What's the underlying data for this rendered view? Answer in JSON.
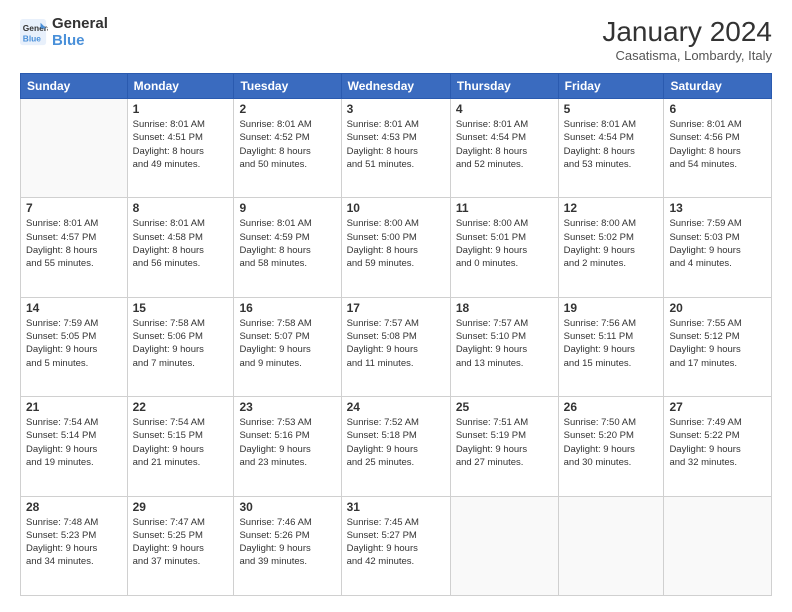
{
  "logo": {
    "line1": "General",
    "line2": "Blue"
  },
  "header": {
    "month_year": "January 2024",
    "location": "Casatisma, Lombardy, Italy"
  },
  "days_of_week": [
    "Sunday",
    "Monday",
    "Tuesday",
    "Wednesday",
    "Thursday",
    "Friday",
    "Saturday"
  ],
  "weeks": [
    [
      {
        "day": "",
        "info": ""
      },
      {
        "day": "1",
        "info": "Sunrise: 8:01 AM\nSunset: 4:51 PM\nDaylight: 8 hours\nand 49 minutes."
      },
      {
        "day": "2",
        "info": "Sunrise: 8:01 AM\nSunset: 4:52 PM\nDaylight: 8 hours\nand 50 minutes."
      },
      {
        "day": "3",
        "info": "Sunrise: 8:01 AM\nSunset: 4:53 PM\nDaylight: 8 hours\nand 51 minutes."
      },
      {
        "day": "4",
        "info": "Sunrise: 8:01 AM\nSunset: 4:54 PM\nDaylight: 8 hours\nand 52 minutes."
      },
      {
        "day": "5",
        "info": "Sunrise: 8:01 AM\nSunset: 4:54 PM\nDaylight: 8 hours\nand 53 minutes."
      },
      {
        "day": "6",
        "info": "Sunrise: 8:01 AM\nSunset: 4:56 PM\nDaylight: 8 hours\nand 54 minutes."
      }
    ],
    [
      {
        "day": "7",
        "info": "Sunrise: 8:01 AM\nSunset: 4:57 PM\nDaylight: 8 hours\nand 55 minutes."
      },
      {
        "day": "8",
        "info": "Sunrise: 8:01 AM\nSunset: 4:58 PM\nDaylight: 8 hours\nand 56 minutes."
      },
      {
        "day": "9",
        "info": "Sunrise: 8:01 AM\nSunset: 4:59 PM\nDaylight: 8 hours\nand 58 minutes."
      },
      {
        "day": "10",
        "info": "Sunrise: 8:00 AM\nSunset: 5:00 PM\nDaylight: 8 hours\nand 59 minutes."
      },
      {
        "day": "11",
        "info": "Sunrise: 8:00 AM\nSunset: 5:01 PM\nDaylight: 9 hours\nand 0 minutes."
      },
      {
        "day": "12",
        "info": "Sunrise: 8:00 AM\nSunset: 5:02 PM\nDaylight: 9 hours\nand 2 minutes."
      },
      {
        "day": "13",
        "info": "Sunrise: 7:59 AM\nSunset: 5:03 PM\nDaylight: 9 hours\nand 4 minutes."
      }
    ],
    [
      {
        "day": "14",
        "info": "Sunrise: 7:59 AM\nSunset: 5:05 PM\nDaylight: 9 hours\nand 5 minutes."
      },
      {
        "day": "15",
        "info": "Sunrise: 7:58 AM\nSunset: 5:06 PM\nDaylight: 9 hours\nand 7 minutes."
      },
      {
        "day": "16",
        "info": "Sunrise: 7:58 AM\nSunset: 5:07 PM\nDaylight: 9 hours\nand 9 minutes."
      },
      {
        "day": "17",
        "info": "Sunrise: 7:57 AM\nSunset: 5:08 PM\nDaylight: 9 hours\nand 11 minutes."
      },
      {
        "day": "18",
        "info": "Sunrise: 7:57 AM\nSunset: 5:10 PM\nDaylight: 9 hours\nand 13 minutes."
      },
      {
        "day": "19",
        "info": "Sunrise: 7:56 AM\nSunset: 5:11 PM\nDaylight: 9 hours\nand 15 minutes."
      },
      {
        "day": "20",
        "info": "Sunrise: 7:55 AM\nSunset: 5:12 PM\nDaylight: 9 hours\nand 17 minutes."
      }
    ],
    [
      {
        "day": "21",
        "info": "Sunrise: 7:54 AM\nSunset: 5:14 PM\nDaylight: 9 hours\nand 19 minutes."
      },
      {
        "day": "22",
        "info": "Sunrise: 7:54 AM\nSunset: 5:15 PM\nDaylight: 9 hours\nand 21 minutes."
      },
      {
        "day": "23",
        "info": "Sunrise: 7:53 AM\nSunset: 5:16 PM\nDaylight: 9 hours\nand 23 minutes."
      },
      {
        "day": "24",
        "info": "Sunrise: 7:52 AM\nSunset: 5:18 PM\nDaylight: 9 hours\nand 25 minutes."
      },
      {
        "day": "25",
        "info": "Sunrise: 7:51 AM\nSunset: 5:19 PM\nDaylight: 9 hours\nand 27 minutes."
      },
      {
        "day": "26",
        "info": "Sunrise: 7:50 AM\nSunset: 5:20 PM\nDaylight: 9 hours\nand 30 minutes."
      },
      {
        "day": "27",
        "info": "Sunrise: 7:49 AM\nSunset: 5:22 PM\nDaylight: 9 hours\nand 32 minutes."
      }
    ],
    [
      {
        "day": "28",
        "info": "Sunrise: 7:48 AM\nSunset: 5:23 PM\nDaylight: 9 hours\nand 34 minutes."
      },
      {
        "day": "29",
        "info": "Sunrise: 7:47 AM\nSunset: 5:25 PM\nDaylight: 9 hours\nand 37 minutes."
      },
      {
        "day": "30",
        "info": "Sunrise: 7:46 AM\nSunset: 5:26 PM\nDaylight: 9 hours\nand 39 minutes."
      },
      {
        "day": "31",
        "info": "Sunrise: 7:45 AM\nSunset: 5:27 PM\nDaylight: 9 hours\nand 42 minutes."
      },
      {
        "day": "",
        "info": ""
      },
      {
        "day": "",
        "info": ""
      },
      {
        "day": "",
        "info": ""
      }
    ]
  ]
}
